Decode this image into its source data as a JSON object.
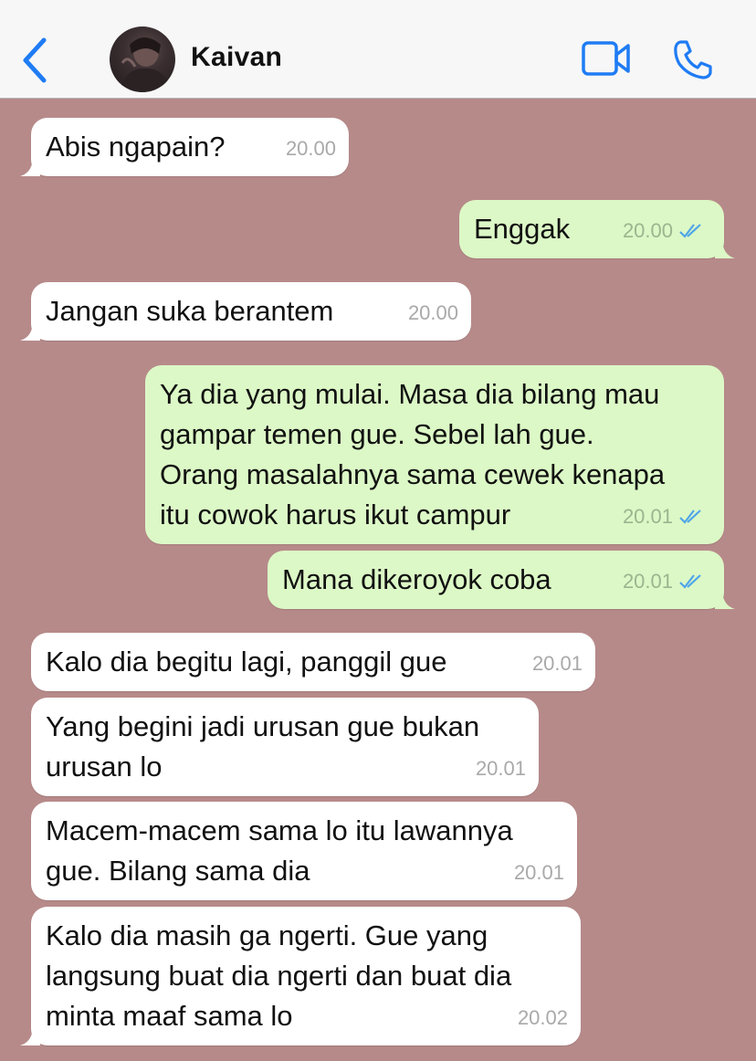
{
  "header": {
    "contact_name": "Kaivan",
    "accent_color": "#1f7cf4",
    "icons": [
      "back-chevron-icon",
      "video-camera-icon",
      "phone-icon"
    ]
  },
  "messages": [
    {
      "direction": "in",
      "text": "Abis ngapain?",
      "time": "20.00"
    },
    {
      "direction": "out",
      "text": "Enggak",
      "time": "20.00",
      "status": "read"
    },
    {
      "direction": "in",
      "text": "Jangan suka berantem",
      "time": "20.00"
    },
    {
      "direction": "out",
      "text": "Ya dia yang mulai. Masa dia bilang mau\ngampar temen gue. Sebel lah gue.\nOrang masalahnya sama cewek kenapa\nitu cowok harus ikut campur",
      "time": "20.01",
      "status": "read"
    },
    {
      "direction": "out",
      "text": "Mana dikeroyok coba",
      "time": "20.01",
      "status": "read"
    },
    {
      "direction": "in",
      "text": "Kalo dia begitu lagi, panggil gue",
      "time": "20.01"
    },
    {
      "direction": "in",
      "text": "Yang begini jadi urusan gue bukan\nurusan lo",
      "time": "20.01"
    },
    {
      "direction": "in",
      "text": "Macem-macem sama lo itu lawannya\ngue. Bilang sama dia",
      "time": "20.01"
    },
    {
      "direction": "in",
      "text": "Kalo dia masih ga ngerti. Gue yang\nlangsung buat dia ngerti dan buat dia\nminta maaf sama lo",
      "time": "20.02"
    }
  ],
  "colors": {
    "chat_background": "#b78a8a",
    "incoming_bubble": "#ffffff",
    "outgoing_bubble": "#dcf8c6",
    "read_ticks": "#4fa6e8"
  }
}
